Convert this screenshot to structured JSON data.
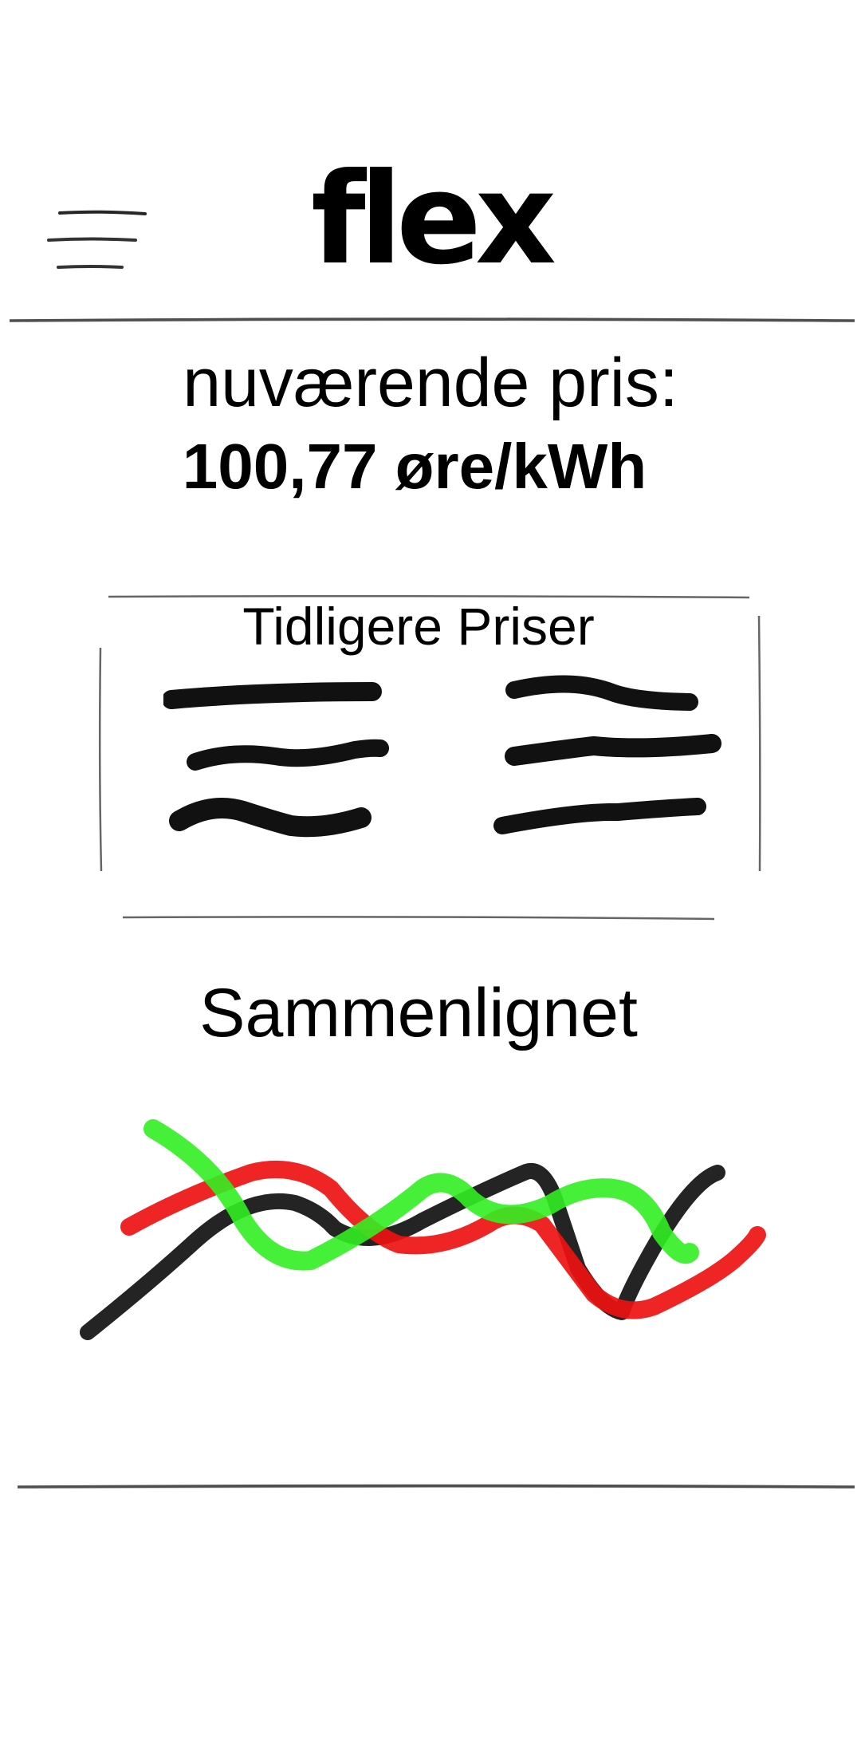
{
  "header": {
    "title": "flex",
    "menu_icon": "hamburger-menu-icon"
  },
  "current_price": {
    "label": "nuværende pris:",
    "value": "100,77 øre/kWh"
  },
  "history": {
    "title": "Tidligere Priser",
    "entry_count": 6
  },
  "comparison": {
    "title": "Sammenlignet",
    "series_colors": [
      "#000000",
      "#ee1111",
      "#33ee22"
    ]
  },
  "colors": {
    "background": "#ffffff",
    "ink": "#000000",
    "divider": "#333333"
  }
}
